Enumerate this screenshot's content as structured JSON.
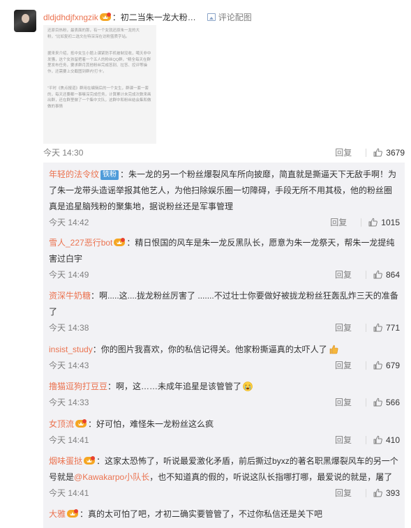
{
  "main_comment": {
    "username": "dldjdhdjfxngzik",
    "text": "：初二当朱一龙大粉…",
    "picture_button": "评论配图",
    "time": "今天 14:30",
    "reply_label": "回复",
    "likes": "3679",
    "embedded_image_lines": [
      "还原目热粉，最表面的那，有一个女就还原朱一龙的大粉，\"比如复初二选文在特深深在访粉篮质字站。",
      "据来来介绍，抵中女生小题上课紧防手机被制没收，噶天非中发骚，这个女孩留把着一个五人的粉丝QQ群，\"精全每天在群里发布任务，要求群月其他粉丝完成答别、拉答、控评等操作，还需要上交截图到群内'打卡'。",
      "\"平时《焦点报道》群用在编辑后的一个女生，群课一套一套的，每天还要都一事嘛深完成任务，计算累计未完成次数来画出群，还在群里做了一个集中文队，这群中和粉丝结会集和做做的事情"
    ]
  },
  "replies": [
    {
      "user": "年轻的法令纹",
      "badge": "铁粉",
      "text": "：朱一龙的另一个粉丝爆裂风车所向披靡，简直就是撕逼天下无敌手啊！为了朱一龙带头造谣举报其他艺人，为他扫除娱乐圈一切障碍，手段无所不用其极，他的粉丝圈真是追星脑残粉的聚集地，据说粉丝还是军事管理",
      "time": "今天 14:42",
      "reply_label": "回复",
      "likes": "1015"
    },
    {
      "user": "雪人_227恶行bot",
      "text": "：精日恨国的风车是朱一龙反黑队长，愿意为朱一龙祭天，帮朱一龙提纯害过白宇",
      "time": "今天 14:49",
      "reply_label": "回复",
      "likes": "864"
    },
    {
      "user": "资深牛奶糖",
      "text": "：啊.....这....拢龙粉丝厉害了 .......不过壮士你要做好被拢龙粉丝狂轰乱炸三天的准备了",
      "time": "今天 14:38",
      "reply_label": "回复",
      "likes": "771"
    },
    {
      "user": "insist_study",
      "text": "：你的图片我喜欢，你的私信记得关。他家粉撕逼真的太吓人了",
      "time": "今天 14:43",
      "reply_label": "回复",
      "likes": "679"
    },
    {
      "user": "撸猫逗狗打豆豆",
      "text": "：啊，这……未成年追星是该管管了",
      "time": "今天 14:33",
      "reply_label": "回复",
      "likes": "566"
    },
    {
      "user": "女顶流",
      "text": "：好可怕，难怪朱一龙粉丝这么疯",
      "time": "今天 14:41",
      "reply_label": "回复",
      "likes": "410"
    },
    {
      "user": "烟味蛋挞",
      "text_before": "：这家太恐怖了，听说最爱激化矛盾，前后撕过byxz的著名职黑爆裂风车的另一个号就是",
      "mention": "@Kawakarpo小队长",
      "text_after": "，也不知道真的假的，听说这队长指哪打哪，最爱说的就是，屠了",
      "time": "今天 14:41",
      "reply_label": "回复",
      "likes": "393"
    },
    {
      "user": "大雅",
      "text": "：真的太可怕了吧，才初二确实要管管了，不过你私信还是关下吧"
    }
  ],
  "colors": {
    "username": "#eb7350",
    "reply_bg": "#f2f2f5",
    "badge_bg": "#4e9bd9",
    "meta_gray": "#808080"
  }
}
